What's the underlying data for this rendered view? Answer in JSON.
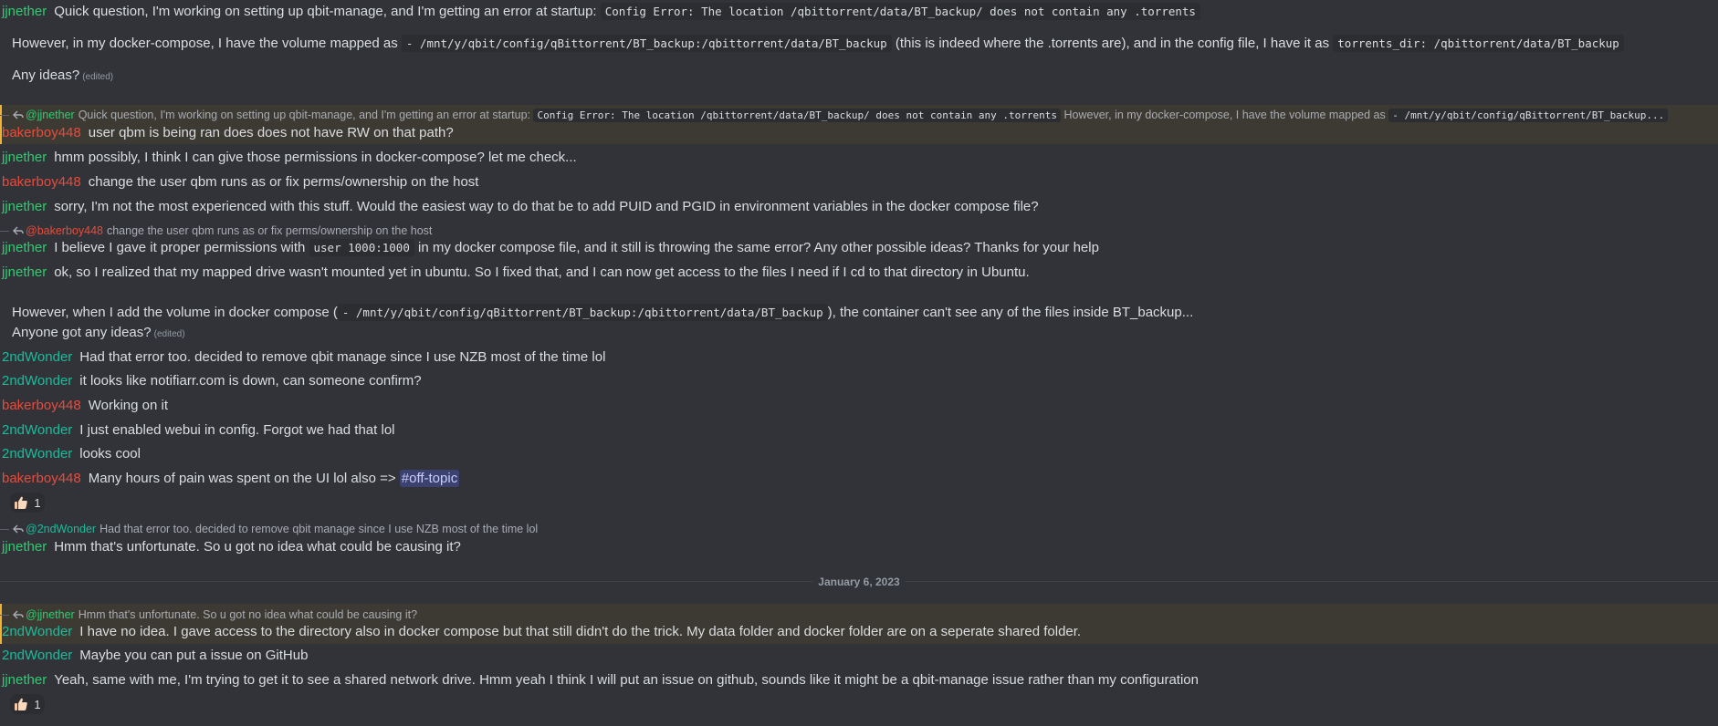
{
  "users": {
    "jjnether": "jjnether",
    "bakerboy448": "bakerboy448",
    "secondwonder": "2ndWonder",
    "at_jjnether": "@jjnether",
    "at_bakerboy448": "@bakerboy448",
    "at_secondwonder": "@2ndWonder"
  },
  "edited_label": "(edited)",
  "m1": {
    "line1_text": "Quick question, I'm working on setting up qbit-manage, and I'm getting an error at startup: ",
    "line1_code": "Config Error: The location /qbittorrent/data/BT_backup/ does not contain any .torrents",
    "line2_text_a": "However, in my docker-compose, I have the volume mapped as ",
    "line2_code_a": "- /mnt/y/qbit/config/qBittorrent/BT_backup:/qbittorrent/data/BT_backup",
    "line2_text_b": " (this is indeed where the .torrents are), and in the config file, I have it as ",
    "line2_code_b": "torrents_dir: /qbittorrent/data/BT_backup",
    "line3_text": "Any ideas?"
  },
  "r1": {
    "reply_text_a": "Quick question, I'm working on setting up qbit-manage, and I'm getting an error at startup: ",
    "reply_code_a": "Config Error: The location /qbittorrent/data/BT_backup/ does not contain any .torrents",
    "reply_text_b": " However, in my docker-compose, I have the volume mapped as ",
    "reply_code_b": "- /mnt/y/qbit/config/qBittorrent/BT_backup...",
    "text": "user qbm is being ran does does not have RW on that path?"
  },
  "m2": {
    "text": "hmm possibly, I think I can give those permissions in docker-compose? let me check..."
  },
  "m3": {
    "text": "change the user qbm runs as or fix perms/ownership on the host"
  },
  "m4": {
    "text": "sorry, I'm not the most experienced with this stuff. Would the easiest way to do that be to add PUID and PGID in environment variables in the docker compose file?"
  },
  "r2": {
    "reply_text": "change the user qbm runs as or fix perms/ownership on the host",
    "text_a": "I believe I gave it proper permissions with ",
    "code": "user 1000:1000",
    "text_b": " in my docker compose file, and it still is throwing the same error? Any other possible ideas? Thanks for your help"
  },
  "m5": {
    "line1_text": "ok, so I realized that my mapped drive wasn't mounted yet in ubuntu. So I fixed that, and I can now get access to the files I need if I cd to that directory in Ubuntu.",
    "line2_text_a": "However, when I add the volume in docker compose (",
    "line2_code": "- /mnt/y/qbit/config/qBittorrent/BT_backup:/qbittorrent/data/BT_backup",
    "line2_text_b": "), the container can't see any of the files inside BT_backup...",
    "line3_text": "Anyone got any ideas?"
  },
  "m6": {
    "text": "Had that error too. decided to remove qbit manage since I use NZB most of the time lol"
  },
  "m7": {
    "text": "it looks like notifiarr.com is down, can someone confirm?"
  },
  "m8": {
    "text": "Working on it"
  },
  "m9": {
    "text": "I just enabled webui in config. Forgot we had that lol"
  },
  "m10": {
    "text": "looks cool"
  },
  "m11": {
    "text": "Many hours of pain was spent on the UI lol also => ",
    "channel_hash": "#",
    "channel": "off-topic",
    "reaction_count": "1",
    "reaction_icon": "thumbs-up-icon"
  },
  "r3": {
    "reply_text": "Had that error too. decided to remove qbit manage since I use NZB most of the time lol",
    "text": "Hmm that's unfortunate. So u got no idea what could be causing it?"
  },
  "date_divider": "January 6, 2023",
  "r4": {
    "reply_text": "Hmm that's unfortunate. So u got no idea what could be causing it?",
    "text": "I have no idea. I gave access to the directory also in docker compose but that still didn't do the trick. My data folder and docker folder are on a seperate shared folder."
  },
  "m12": {
    "text": "Maybe you can put a issue on GitHub"
  },
  "m13": {
    "text": "Yeah, same with me, I'm trying to get it to see a shared network drive. Hmm yeah I think I will put an issue on github, sounds like it might be a qbit-manage issue rather than my configuration",
    "reaction_count": "1",
    "reaction_icon": "thumbs-up-icon"
  },
  "colors": {
    "background": "#313338",
    "jjnether": "#2ecc71",
    "bakerboy448": "#e74c3c",
    "secondwonder": "#1abc9c",
    "highlight": "#3d3a33",
    "mention": "#3c4270"
  }
}
